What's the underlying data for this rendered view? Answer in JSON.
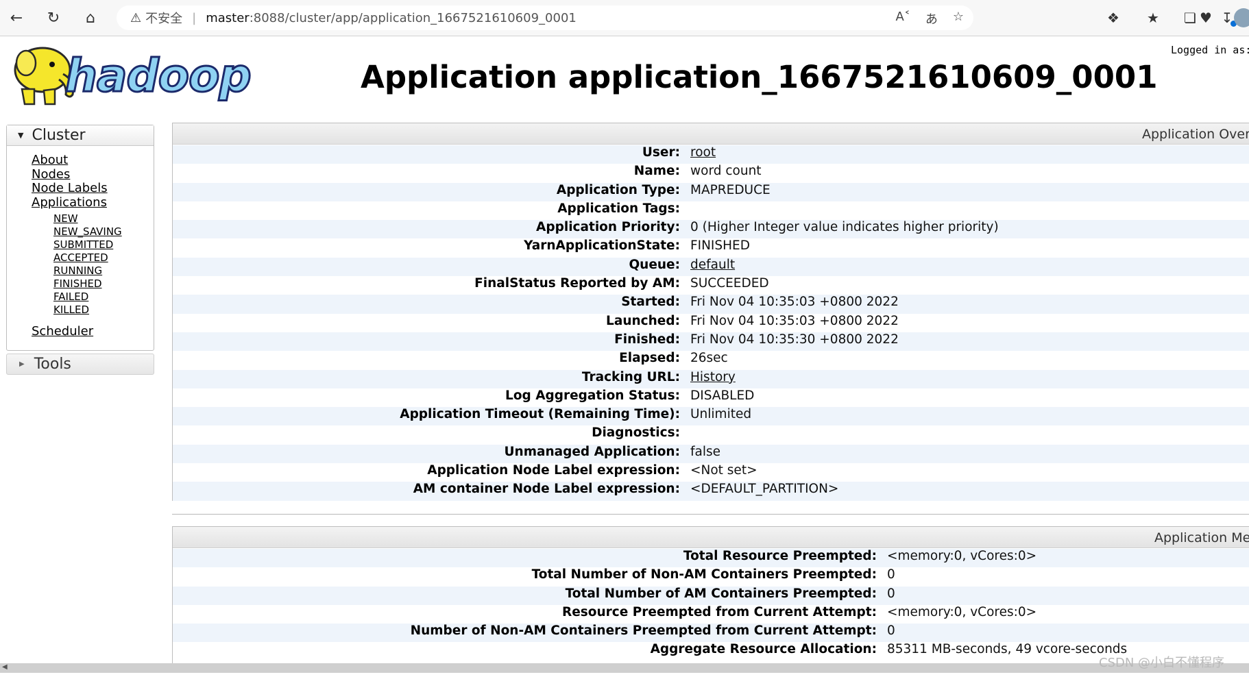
{
  "browser": {
    "insecure_label": "不安全",
    "url_host": "master",
    "url_path": ":8088/cluster/app/application_1667521610609_0001",
    "back_icon": "back-arrow-icon",
    "refresh_icon": "refresh-icon",
    "home_icon": "home-icon"
  },
  "header": {
    "logo_text": "hadoop",
    "title": "Application application_1667521610609_0001",
    "logged_in": "Logged in as:"
  },
  "sidebar": {
    "cluster_label": "Cluster",
    "items": [
      "About",
      "Nodes",
      "Node Labels",
      "Applications"
    ],
    "app_states": [
      "NEW",
      "NEW_SAVING",
      "SUBMITTED",
      "ACCEPTED",
      "RUNNING",
      "FINISHED",
      "FAILED",
      "KILLED"
    ],
    "scheduler": "Scheduler",
    "tools_label": "Tools"
  },
  "overview": {
    "heading": "Application Over",
    "rows": [
      {
        "key": "User:",
        "value": "root",
        "link": true
      },
      {
        "key": "Name:",
        "value": "word count",
        "link": false
      },
      {
        "key": "Application Type:",
        "value": "MAPREDUCE",
        "link": false
      },
      {
        "key": "Application Tags:",
        "value": "",
        "link": false
      },
      {
        "key": "Application Priority:",
        "value": "0 (Higher Integer value indicates higher priority)",
        "link": false
      },
      {
        "key": "YarnApplicationState:",
        "value": "FINISHED",
        "link": false
      },
      {
        "key": "Queue:",
        "value": "default",
        "link": true
      },
      {
        "key": "FinalStatus Reported by AM:",
        "value": "SUCCEEDED",
        "link": false
      },
      {
        "key": "Started:",
        "value": "Fri Nov 04 10:35:03 +0800 2022",
        "link": false
      },
      {
        "key": "Launched:",
        "value": "Fri Nov 04 10:35:03 +0800 2022",
        "link": false
      },
      {
        "key": "Finished:",
        "value": "Fri Nov 04 10:35:30 +0800 2022",
        "link": false
      },
      {
        "key": "Elapsed:",
        "value": "26sec",
        "link": false
      },
      {
        "key": "Tracking URL:",
        "value": "History",
        "link": true
      },
      {
        "key": "Log Aggregation Status:",
        "value": "DISABLED",
        "link": false
      },
      {
        "key": "Application Timeout (Remaining Time):",
        "value": "Unlimited",
        "link": false
      },
      {
        "key": "Diagnostics:",
        "value": "",
        "link": false
      },
      {
        "key": "Unmanaged Application:",
        "value": "false",
        "link": false
      },
      {
        "key": "Application Node Label expression:",
        "value": "<Not set>",
        "link": false
      },
      {
        "key": "AM container Node Label expression:",
        "value": "<DEFAULT_PARTITION>",
        "link": false
      }
    ]
  },
  "metrics": {
    "heading": "Application Me",
    "rows": [
      {
        "key": "Total Resource Preempted:",
        "value": "<memory:0, vCores:0>"
      },
      {
        "key": "Total Number of Non-AM Containers Preempted:",
        "value": "0"
      },
      {
        "key": "Total Number of AM Containers Preempted:",
        "value": "0"
      },
      {
        "key": "Resource Preempted from Current Attempt:",
        "value": "<memory:0, vCores:0>"
      },
      {
        "key": "Number of Non-AM Containers Preempted from Current Attempt:",
        "value": "0"
      },
      {
        "key": "Aggregate Resource Allocation:",
        "value": "85311 MB-seconds, 49 vcore-seconds"
      }
    ]
  },
  "watermark": "CSDN @小白不懂程序"
}
